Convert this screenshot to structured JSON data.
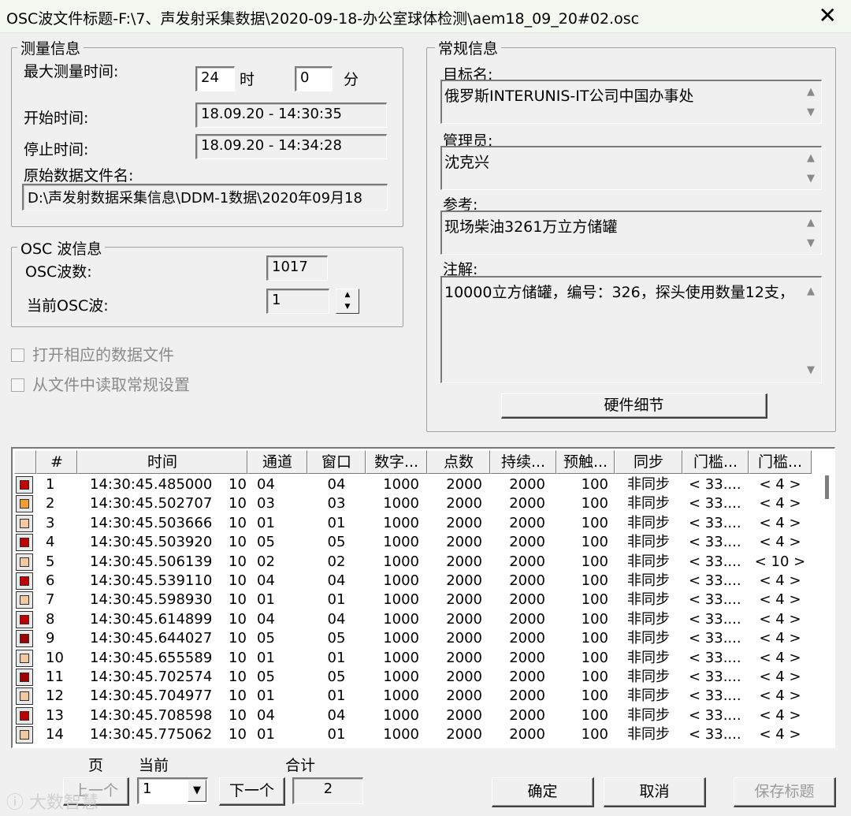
{
  "window": {
    "title": "OSC波文件标题-F:\\7、声发射采集数据\\2020-09-18-办公室球体检测\\aem18_09_20#02.osc",
    "close_glyph": "✕"
  },
  "measure": {
    "legend": "测量信息",
    "max_time_label": "最大测量时间:",
    "hours_value": "24",
    "hours_unit": "时",
    "minutes_value": "0",
    "minutes_unit": "分",
    "start_label": "开始时间:",
    "start_value": "18.09.20  -  14:30:35",
    "stop_label": "停止时间:",
    "stop_value": "18.09.20  -  14:34:28",
    "raw_file_label": "原始数据文件名:",
    "raw_file_value": "D:\\声发射数据采集信息\\DDM-1数据\\2020年09月18"
  },
  "osc": {
    "legend": "OSC 波信息",
    "count_label": "OSC波数:",
    "count_value": "1017",
    "current_label": "当前OSC波:",
    "current_value": "1"
  },
  "checks": [
    {
      "label": "打开相应的数据文件",
      "checked": false
    },
    {
      "label": "从文件中读取常规设置",
      "checked": false
    }
  ],
  "general": {
    "legend": "常规信息",
    "target_label": "目标名:",
    "target_value": "俄罗斯INTERUNIS-IT公司中国办事处",
    "admin_label": "管理员:",
    "admin_value": "沈克兴",
    "ref_label": "参考:",
    "ref_value": "现场柴油3261万立方储罐",
    "note_label": "注解:",
    "note_value": "10000立方储罐，编号：326，探头使用数量12支，",
    "hardware_button": "硬件细节"
  },
  "table": {
    "columns": [
      "#",
      "时间",
      "通道",
      "窗口",
      "数字...",
      "点数",
      "持续...",
      "预触...",
      "同步",
      "门槛...",
      "门槛..."
    ],
    "rows": [
      {
        "n": "1",
        "time": "14:30:45.485000",
        "ch": "10",
        "chan": "04",
        "win": "04",
        "dig": "1000",
        "pts": "2000",
        "dur": "2000",
        "pre": "100",
        "sync": "非同步",
        "th1": "< 33....",
        "th2": "< 4 >",
        "color": "#c00000"
      },
      {
        "n": "2",
        "time": "14:30:45.502707",
        "ch": "10",
        "chan": "03",
        "win": "03",
        "dig": "1000",
        "pts": "2000",
        "dur": "2000",
        "pre": "100",
        "sync": "非同步",
        "th1": "< 33....",
        "th2": "< 4 >",
        "color": "#f0a030"
      },
      {
        "n": "3",
        "time": "14:30:45.503666",
        "ch": "10",
        "chan": "01",
        "win": "01",
        "dig": "1000",
        "pts": "2000",
        "dur": "2000",
        "pre": "100",
        "sync": "非同步",
        "th1": "< 33....",
        "th2": "< 4 >",
        "color": "#f2c8a0"
      },
      {
        "n": "4",
        "time": "14:30:45.503920",
        "ch": "10",
        "chan": "05",
        "win": "05",
        "dig": "1000",
        "pts": "2000",
        "dur": "2000",
        "pre": "100",
        "sync": "非同步",
        "th1": "< 33....",
        "th2": "< 4 >",
        "color": "#c00000"
      },
      {
        "n": "5",
        "time": "14:30:45.506139",
        "ch": "10",
        "chan": "02",
        "win": "02",
        "dig": "1000",
        "pts": "2000",
        "dur": "2000",
        "pre": "100",
        "sync": "非同步",
        "th1": "< 33....",
        "th2": "< 10 >",
        "color": "#f2c8a0"
      },
      {
        "n": "6",
        "time": "14:30:45.539110",
        "ch": "10",
        "chan": "04",
        "win": "04",
        "dig": "1000",
        "pts": "2000",
        "dur": "2000",
        "pre": "100",
        "sync": "非同步",
        "th1": "< 33....",
        "th2": "< 4 >",
        "color": "#c00000"
      },
      {
        "n": "7",
        "time": "14:30:45.598930",
        "ch": "10",
        "chan": "01",
        "win": "01",
        "dig": "1000",
        "pts": "2000",
        "dur": "2000",
        "pre": "100",
        "sync": "非同步",
        "th1": "< 33....",
        "th2": "< 4 >",
        "color": "#f2c8a0"
      },
      {
        "n": "8",
        "time": "14:30:45.614899",
        "ch": "10",
        "chan": "04",
        "win": "04",
        "dig": "1000",
        "pts": "2000",
        "dur": "2000",
        "pre": "100",
        "sync": "非同步",
        "th1": "< 33....",
        "th2": "< 4 >",
        "color": "#c00000"
      },
      {
        "n": "9",
        "time": "14:30:45.644027",
        "ch": "10",
        "chan": "05",
        "win": "05",
        "dig": "1000",
        "pts": "2000",
        "dur": "2000",
        "pre": "100",
        "sync": "非同步",
        "th1": "< 33....",
        "th2": "< 4 >",
        "color": "#a00000"
      },
      {
        "n": "10",
        "time": "14:30:45.655589",
        "ch": "10",
        "chan": "01",
        "win": "01",
        "dig": "1000",
        "pts": "2000",
        "dur": "2000",
        "pre": "100",
        "sync": "非同步",
        "th1": "< 33....",
        "th2": "< 4 >",
        "color": "#f2c8a0"
      },
      {
        "n": "11",
        "time": "14:30:45.702574",
        "ch": "10",
        "chan": "05",
        "win": "05",
        "dig": "1000",
        "pts": "2000",
        "dur": "2000",
        "pre": "100",
        "sync": "非同步",
        "th1": "< 33....",
        "th2": "< 4 >",
        "color": "#a00000"
      },
      {
        "n": "12",
        "time": "14:30:45.704977",
        "ch": "10",
        "chan": "01",
        "win": "01",
        "dig": "1000",
        "pts": "2000",
        "dur": "2000",
        "pre": "100",
        "sync": "非同步",
        "th1": "< 33....",
        "th2": "< 4 >",
        "color": "#f2c8a0"
      },
      {
        "n": "13",
        "time": "14:30:45.708598",
        "ch": "10",
        "chan": "04",
        "win": "04",
        "dig": "1000",
        "pts": "2000",
        "dur": "2000",
        "pre": "100",
        "sync": "非同步",
        "th1": "< 33....",
        "th2": "< 4 >",
        "color": "#c00000"
      },
      {
        "n": "14",
        "time": "14:30:45.775062",
        "ch": "10",
        "chan": "01",
        "win": "01",
        "dig": "1000",
        "pts": "2000",
        "dur": "2000",
        "pre": "100",
        "sync": "非同步",
        "th1": "< 33....",
        "th2": "< 4 >",
        "color": "#f2c8a0"
      }
    ]
  },
  "footer": {
    "page_label": "页",
    "current_label": "当前",
    "total_label": "合计",
    "prev_button": "上一个",
    "page_select_value": "1",
    "next_button": "下一个",
    "total_value": "2",
    "ok_button": "确定",
    "cancel_button": "取消",
    "save_button": "保存标题",
    "watermark": "大数智慧"
  }
}
